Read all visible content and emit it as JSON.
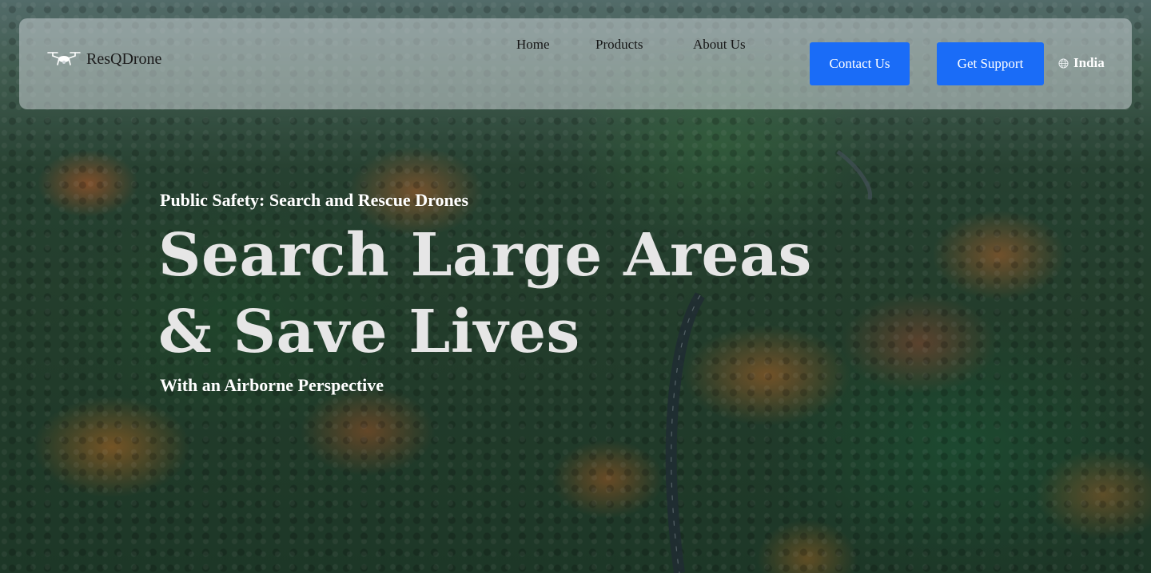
{
  "header": {
    "brand_name": "ResQDrone",
    "logo_icon": "drone-icon",
    "nav": {
      "home": "Home",
      "products": "Products",
      "about": "About Us"
    },
    "buttons": {
      "contact": "Contact Us",
      "support": "Get Support"
    },
    "locale": {
      "icon": "globe-icon",
      "label": "India"
    }
  },
  "hero": {
    "eyebrow": "Public Safety: Search and Rescue Drones",
    "title_line_1": "Search Large Areas",
    "title_line_2": "& Save Lives",
    "subtitle": "With an Airborne Perspective"
  },
  "colors": {
    "button_bg": "#1a6cf7",
    "button_text": "#ffffff",
    "navbar_bg": "#c8d0d4"
  }
}
